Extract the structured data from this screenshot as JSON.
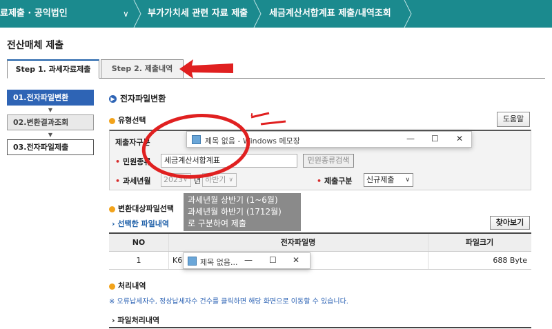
{
  "nav": {
    "crumb1": "료제출 · 공익법인",
    "crumb2": "부가가치세 관련 자료 제출",
    "crumb3": "세금계산서합계표 제출/내역조회",
    "dropdown_icon": "chevron-down-icon"
  },
  "page_title": "전산매체 제출",
  "tabs": [
    {
      "label": "Step 1. 과세자료제출",
      "active": true
    },
    {
      "label": "Step 2. 제출내역",
      "active": false
    }
  ],
  "steps": [
    {
      "label": "01.전자파일변환"
    },
    {
      "label": "02.변환결과조회"
    },
    {
      "label": "03.전자파일제출"
    }
  ],
  "main": {
    "section_title": "전자파일변환",
    "type_select_label": "유형선택",
    "help_button": "도움말",
    "form": {
      "submitter_label": "제출자구분",
      "complaint_label": "민원종류",
      "complaint_value": "세금계산서합계표",
      "complaint_search_button": "민원종류검색",
      "tax_year_label": "과세년월",
      "tax_year_value": "2023",
      "year_suffix": "년",
      "half_value": "하반기",
      "submit_type_label": "제출구분",
      "submit_type_value": "신규제출"
    },
    "file_select_label": "변환대상파일선택",
    "selected_file_link": "› 선택한 파일내역",
    "browse_button": "찾아보기",
    "table": {
      "headers": [
        "NO",
        "전자파일명",
        "파일크기"
      ],
      "rows": [
        {
          "no": "1",
          "name": "K6",
          "size": "688 Byte"
        }
      ]
    },
    "process_label": "처리내역",
    "process_note": "※ 오류납세자수, 정상납세자수 건수를 클릭하면 해당 화면으로 이동할 수 있습니다.",
    "file_process_link": "› 파일처리내역"
  },
  "notepad1": {
    "title": "제목 없음 - Windows 메모장",
    "min": "—",
    "max": "☐",
    "close": "✕"
  },
  "notepad2": {
    "title": "제목 없음...",
    "min": "—",
    "max": "☐",
    "close": "✕"
  },
  "tooltip": {
    "line1": "과세년월 상반기 (1~6월)",
    "line2": "과세년월 하반기 (1712월)",
    "line3": "로 구분하여 제출"
  },
  "colors": {
    "topbar": "#1b8a8e",
    "step_active": "#2e64b5",
    "annotation": "#d62b2b"
  }
}
